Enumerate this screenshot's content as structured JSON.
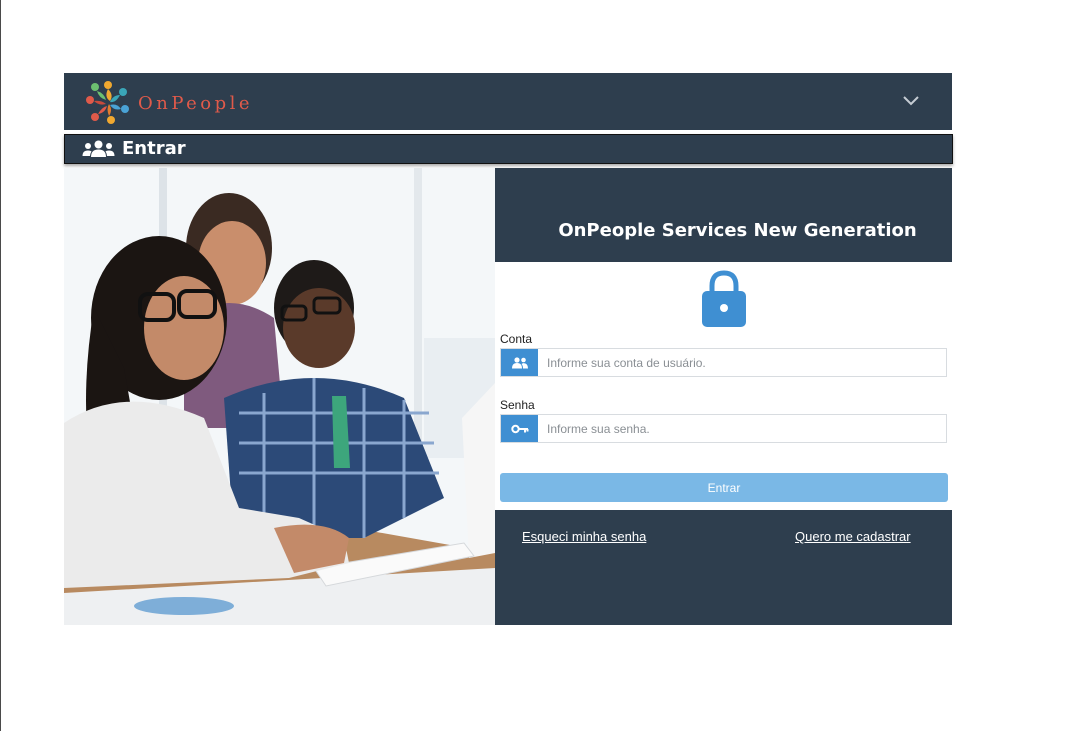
{
  "header": {
    "brand": "OnPeople"
  },
  "subheader": {
    "title": "Entrar"
  },
  "hero": {
    "headline": "OnPeople Services New Generation"
  },
  "form": {
    "account_label": "Conta",
    "account_placeholder": "Informe sua conta de usuário.",
    "password_label": "Senha",
    "password_placeholder": "Informe sua senha.",
    "submit_label": "Entrar"
  },
  "footer": {
    "forgot_link": "Esqueci minha senha",
    "register_link": "Quero me cadastrar"
  },
  "colors": {
    "navy": "#2e3e4e",
    "accent_blue": "#3f8fd2",
    "button_blue": "#7ab8e6",
    "brand_red": "#e05a4a"
  },
  "icons": [
    "onpeople-logo-icon",
    "chevron-down-icon",
    "users-icon",
    "lock-icon",
    "key-icon"
  ]
}
